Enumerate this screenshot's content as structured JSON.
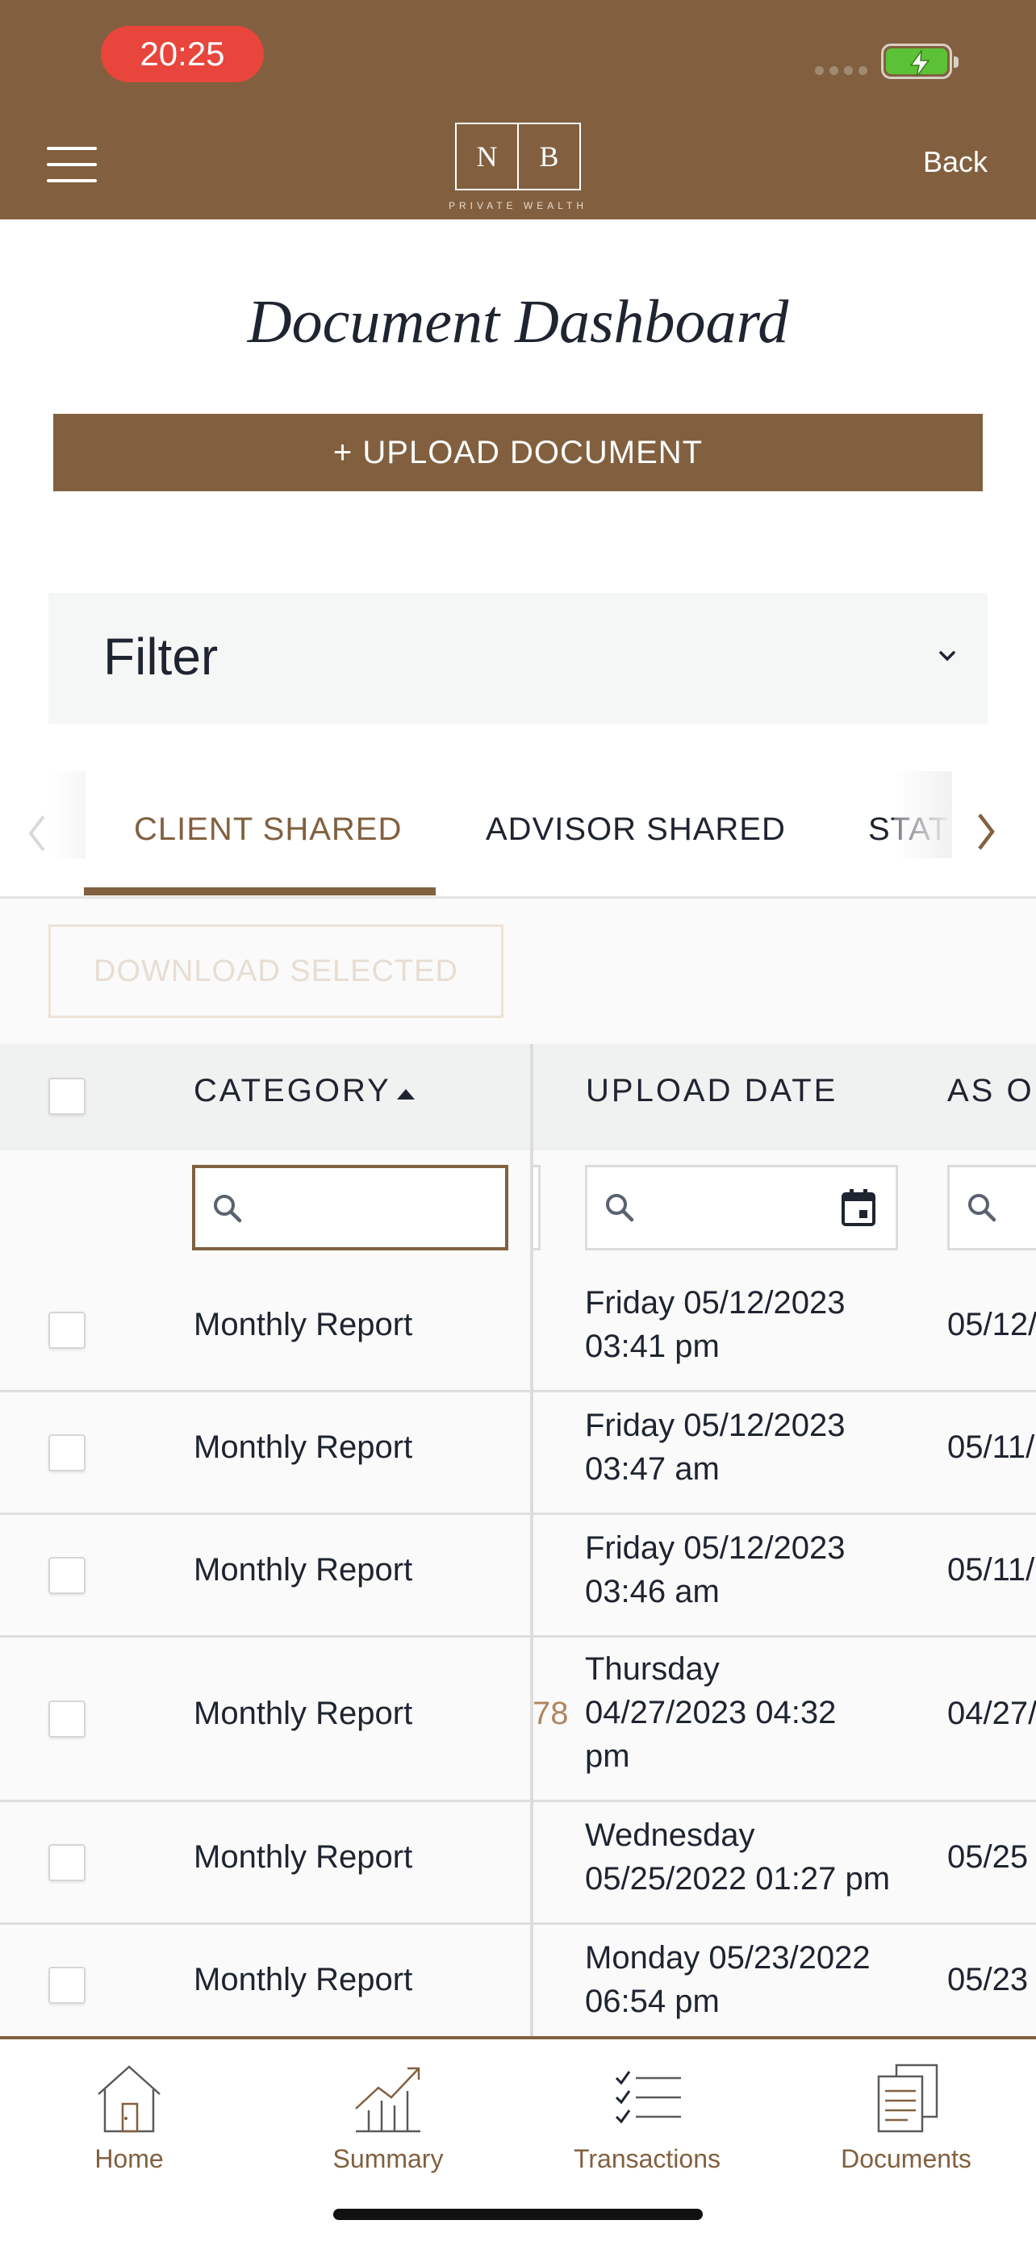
{
  "status_bar": {
    "time": "20:25"
  },
  "header": {
    "logo_left": "N",
    "logo_right": "B",
    "logo_subtitle": "PRIVATE WEALTH",
    "back_label": "Back"
  },
  "page": {
    "title": "Document Dashboard",
    "upload_label": "+ UPLOAD DOCUMENT",
    "filter_label": "Filter"
  },
  "tabs": [
    {
      "label": "CLIENT SHARED",
      "active": true
    },
    {
      "label": "ADVISOR SHARED",
      "active": false
    },
    {
      "label": "STATE",
      "active": false
    }
  ],
  "download_selected_label": "DOWNLOAD SELECTED",
  "table": {
    "columns": [
      "CATEGORY",
      "UPLOAD DATE",
      "AS O"
    ],
    "sort": {
      "column": "CATEGORY",
      "direction": "ascending"
    },
    "rows": [
      {
        "category": "Monthly Report",
        "upload_date_1": "Friday 05/12/2023",
        "upload_date_2": "03:41 pm",
        "upload_date_3": "",
        "as_of": "05/12/"
      },
      {
        "category": "Monthly Report",
        "upload_date_1": "Friday 05/12/2023",
        "upload_date_2": "03:47 am",
        "upload_date_3": "",
        "as_of": "05/11/"
      },
      {
        "category": "Monthly Report",
        "upload_date_1": "Friday 05/12/2023",
        "upload_date_2": "03:46 am",
        "upload_date_3": "",
        "as_of": "05/11/"
      },
      {
        "category": "Monthly Report",
        "upload_date_1": "Thursday",
        "upload_date_2": "04/27/2023 04:32",
        "upload_date_3": "pm",
        "as_of": "04/27/",
        "peek": "78"
      },
      {
        "category": "Monthly Report",
        "upload_date_1": "Wednesday",
        "upload_date_2": "05/25/2022 01:27 pm",
        "upload_date_3": "",
        "as_of": "05/25"
      },
      {
        "category": "Monthly Report",
        "upload_date_1": "Monday 05/23/2022",
        "upload_date_2": "06:54 pm",
        "upload_date_3": "",
        "as_of": "05/23"
      }
    ]
  },
  "bottom_nav": [
    {
      "label": "Home",
      "icon": "house-icon"
    },
    {
      "label": "Summary",
      "icon": "bar-chart-trend-icon"
    },
    {
      "label": "Transactions",
      "icon": "checklist-icon"
    },
    {
      "label": "Documents",
      "icon": "documents-icon"
    }
  ],
  "colors": {
    "brand": "#82603f",
    "status_pill": "#e8453c",
    "battery": "#5bc236",
    "text": "#1e2430"
  }
}
